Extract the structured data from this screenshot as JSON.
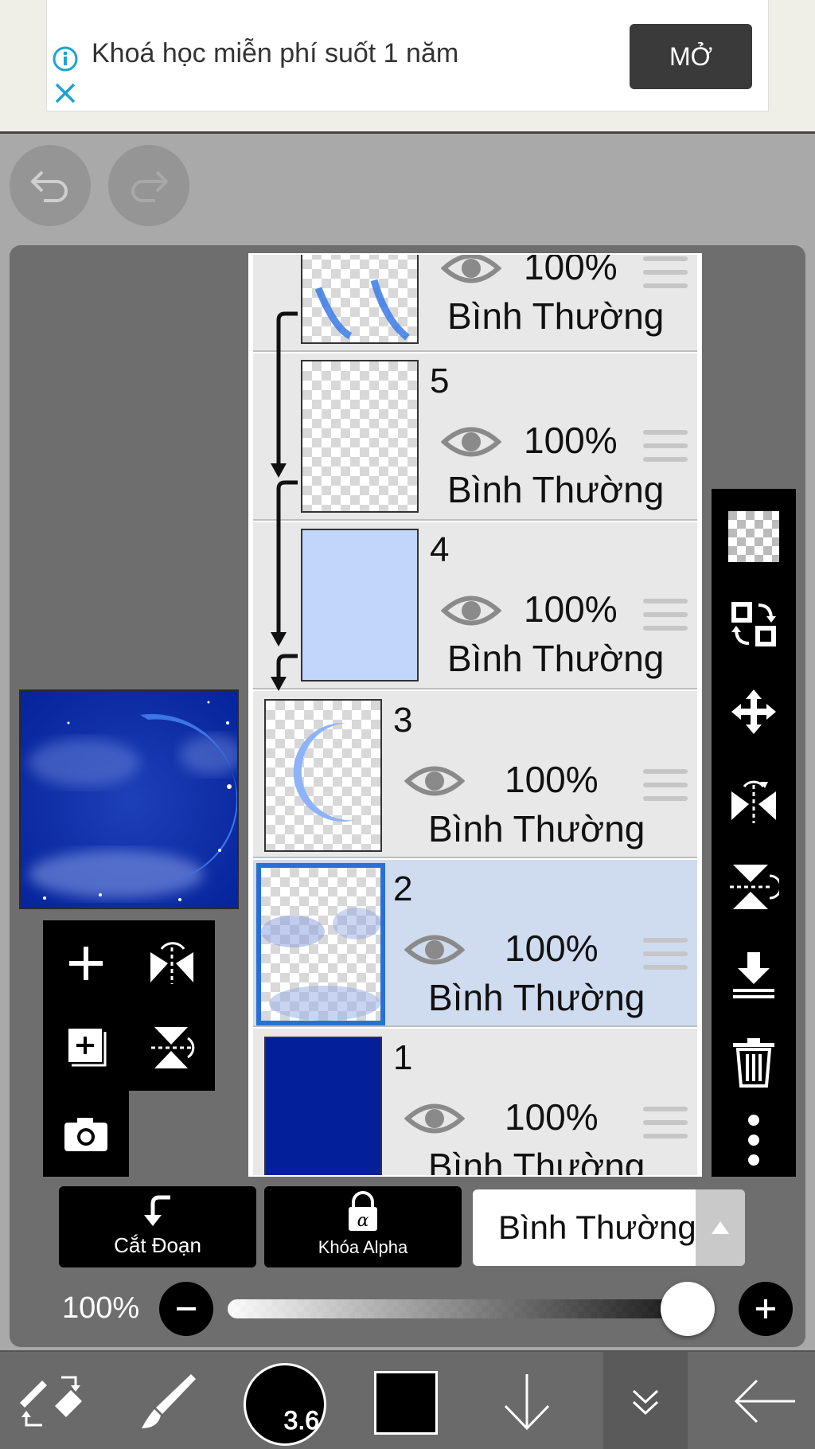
{
  "ad": {
    "text": "Khoá học miễn phí suốt 1 năm",
    "button": "MỞ"
  },
  "layers": [
    {
      "number": "",
      "opacity": "100%",
      "blend": "Bình Thường"
    },
    {
      "number": "5",
      "opacity": "100%",
      "blend": "Bình Thường"
    },
    {
      "number": "4",
      "opacity": "100%",
      "blend": "Bình Thường"
    },
    {
      "number": "3",
      "opacity": "100%",
      "blend": "Bình Thường"
    },
    {
      "number": "2",
      "opacity": "100%",
      "blend": "Bình Thường"
    },
    {
      "number": "1",
      "opacity": "100%",
      "blend": "Bình Thường"
    }
  ],
  "actions": {
    "clip_label": "Cắt Đoạn",
    "alpha_lock_label": "Khóa Alpha",
    "blend_mode": "Bình Thường"
  },
  "opacity": {
    "label": "100%",
    "level": 1.0
  },
  "toolbar": {
    "brush_size": "3.6",
    "current_color": "#000000"
  },
  "colors": {
    "selected_row": "#cfdbef",
    "accent_blue": "#2a6fd6",
    "layer4_fill": "#c2d6fb",
    "layer1_fill": "#03209a"
  }
}
